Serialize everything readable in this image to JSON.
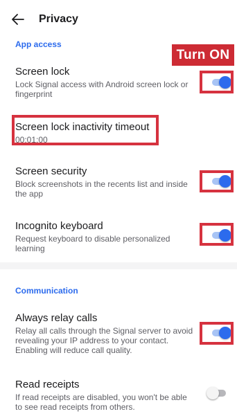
{
  "header": {
    "title": "Privacy",
    "back_icon": "arrow-left-icon"
  },
  "annotation": {
    "banner": "Turn ON",
    "highlight_color": "#d6323f"
  },
  "sections": {
    "app_access": {
      "label": "App access"
    },
    "communication": {
      "label": "Communication"
    }
  },
  "settings": {
    "screen_lock": {
      "title": "Screen lock",
      "description": "Lock Signal access with Android screen lock or fingerprint",
      "enabled": true
    },
    "inactivity_timeout": {
      "title": "Screen lock inactivity timeout",
      "value": "00:01:00"
    },
    "screen_security": {
      "title": "Screen security",
      "description": "Block screenshots in the recents list and inside the app",
      "enabled": true
    },
    "incognito_keyboard": {
      "title": "Incognito keyboard",
      "description": "Request keyboard to disable personalized learning",
      "enabled": true
    },
    "always_relay_calls": {
      "title": "Always relay calls",
      "description": "Relay all calls through the Signal server to avoid revealing your IP address to your contact. Enabling will reduce call quality.",
      "enabled": true
    },
    "read_receipts": {
      "title": "Read receipts",
      "description": "If read receipts are disabled, you won't be able to see read receipts from others.",
      "enabled": false
    }
  },
  "colors": {
    "accent": "#2c6bed",
    "annotation_red": "#cd2b34"
  }
}
